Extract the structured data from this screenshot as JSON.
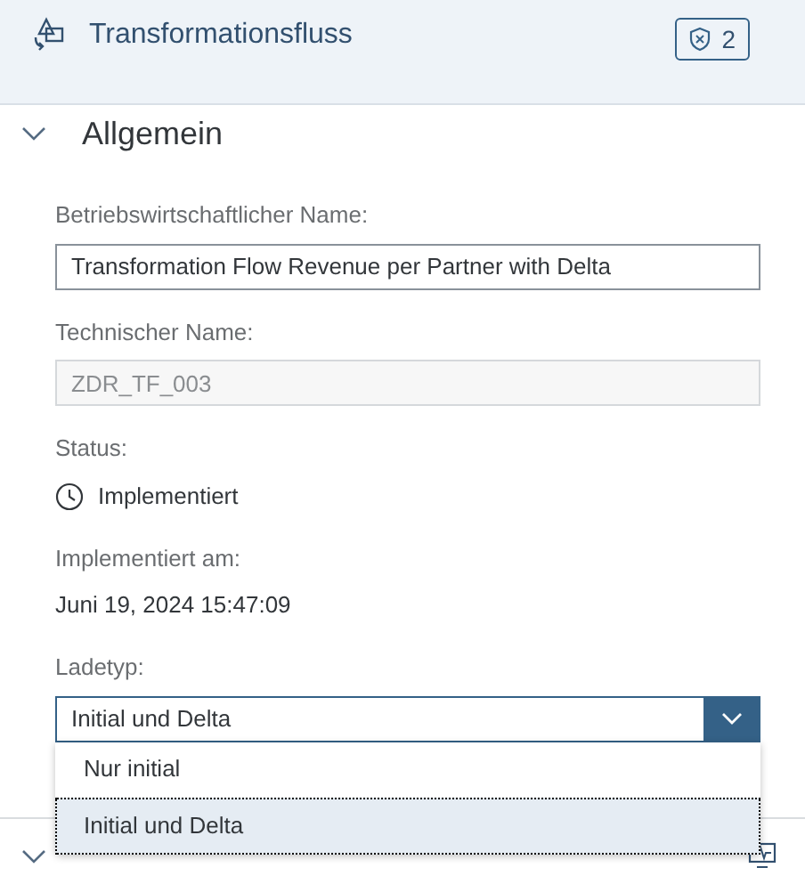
{
  "header": {
    "title": "Transformationsfluss",
    "badge_count": "2"
  },
  "section": {
    "title": "Allgemein",
    "expanded": true
  },
  "fields": [
    {
      "kind": "input",
      "label": "Betriebswirtschaftlicher Name:",
      "value": "Transformation Flow Revenue per Partner with Delta",
      "disabled": false
    },
    {
      "kind": "input",
      "label": "Technischer Name:",
      "value": "ZDR_TF_003",
      "disabled": true
    },
    {
      "kind": "status",
      "label": "Status:",
      "value": "Implementiert"
    },
    {
      "kind": "text",
      "label": "Implementiert am:",
      "value": "Juni 19, 2024 15:47:09"
    }
  ],
  "load_type": {
    "label": "Ladetyp:",
    "value": "Initial und Delta",
    "open": true,
    "options": [
      {
        "label": "Nur initial",
        "selected": false
      },
      {
        "label": "Initial und Delta",
        "selected": true
      }
    ]
  },
  "next_section": {
    "expanded": true
  }
}
